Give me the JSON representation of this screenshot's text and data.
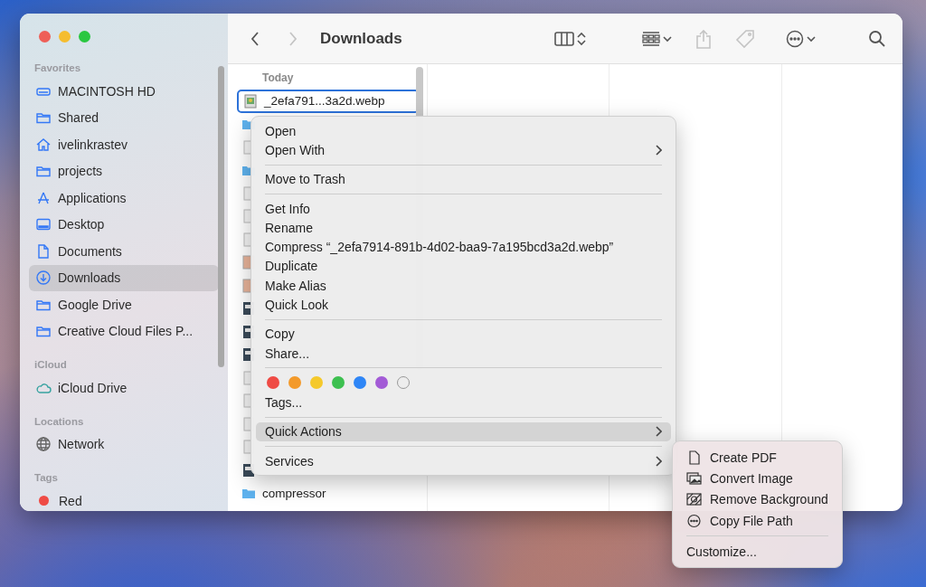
{
  "window": {
    "title": "Downloads"
  },
  "toolbar": {
    "back_disabled": false,
    "forward_disabled": true,
    "share_disabled": true,
    "tags_disabled": true
  },
  "sidebar": {
    "sections": [
      {
        "heading": "Favorites",
        "items": [
          {
            "label": "MACINTOSH HD",
            "kind": "drive",
            "selected": false
          },
          {
            "label": "Shared",
            "kind": "folder",
            "selected": false
          },
          {
            "label": "ivelinkrastev",
            "kind": "home",
            "selected": false
          },
          {
            "label": "projects",
            "kind": "folder",
            "selected": false
          },
          {
            "label": "Applications",
            "kind": "apps",
            "selected": false
          },
          {
            "label": "Desktop",
            "kind": "desktop",
            "selected": false
          },
          {
            "label": "Documents",
            "kind": "document",
            "selected": false
          },
          {
            "label": "Downloads",
            "kind": "download",
            "selected": true
          },
          {
            "label": "Google Drive",
            "kind": "folder",
            "selected": false
          },
          {
            "label": "Creative Cloud Files P...",
            "kind": "folder",
            "selected": false
          }
        ]
      },
      {
        "heading": "iCloud",
        "items": [
          {
            "label": "iCloud Drive",
            "kind": "cloud",
            "selected": false
          }
        ]
      },
      {
        "heading": "Locations",
        "items": [
          {
            "label": "Network",
            "kind": "globe",
            "selected": false
          }
        ]
      },
      {
        "heading": "Tags",
        "items": [
          {
            "label": "Red",
            "kind": "tag",
            "color": "#ef4b45",
            "selected": false
          }
        ]
      }
    ]
  },
  "file_list": {
    "heading": "Today",
    "items": [
      {
        "name": "_2efa791...3a2d.webp",
        "kind": "image",
        "selected": true
      },
      {
        "kind": "folder",
        "selected": false
      },
      {
        "kind": "doc",
        "selected": false
      },
      {
        "kind": "folder",
        "selected": false
      },
      {
        "kind": "doc",
        "selected": false
      },
      {
        "kind": "doc",
        "selected": false
      },
      {
        "kind": "doc",
        "selected": false
      },
      {
        "kind": "photo",
        "selected": false
      },
      {
        "kind": "photo",
        "selected": false
      },
      {
        "kind": "app",
        "selected": false
      },
      {
        "kind": "app",
        "selected": false
      },
      {
        "kind": "app",
        "selected": false
      },
      {
        "kind": "doc",
        "selected": false
      },
      {
        "kind": "doc",
        "selected": false
      },
      {
        "kind": "doc",
        "selected": false
      },
      {
        "kind": "doc",
        "selected": false
      },
      {
        "kind": "app",
        "selected": false
      },
      {
        "name": "compressor",
        "kind": "folder",
        "selected": false
      }
    ]
  },
  "context_menu": {
    "items": [
      {
        "kind": "item",
        "label": "Open",
        "submenu": false,
        "selected": false
      },
      {
        "kind": "item",
        "label": "Open With",
        "submenu": true,
        "selected": false
      },
      {
        "kind": "separator"
      },
      {
        "kind": "item",
        "label": "Move to Trash",
        "submenu": false,
        "selected": false
      },
      {
        "kind": "separator"
      },
      {
        "kind": "item",
        "label": "Get Info",
        "submenu": false,
        "selected": false
      },
      {
        "kind": "item",
        "label": "Rename",
        "submenu": false,
        "selected": false
      },
      {
        "kind": "item",
        "label": "Compress “_2efa7914-891b-4d02-baa9-7a195bcd3a2d.webp”",
        "submenu": false,
        "selected": false
      },
      {
        "kind": "item",
        "label": "Duplicate",
        "submenu": false,
        "selected": false
      },
      {
        "kind": "item",
        "label": "Make Alias",
        "submenu": false,
        "selected": false
      },
      {
        "kind": "item",
        "label": "Quick Look",
        "submenu": false,
        "selected": false
      },
      {
        "kind": "separator"
      },
      {
        "kind": "item",
        "label": "Copy",
        "submenu": false,
        "selected": false
      },
      {
        "kind": "item",
        "label": "Share...",
        "submenu": false,
        "selected": false
      },
      {
        "kind": "separator"
      },
      {
        "kind": "tags",
        "tags": [
          {
            "kind": "color",
            "color": "#ef4b45"
          },
          {
            "kind": "color",
            "color": "#f39a2b"
          },
          {
            "kind": "color",
            "color": "#f5c92b"
          },
          {
            "kind": "color",
            "color": "#3dc050"
          },
          {
            "kind": "color",
            "color": "#2f86f6"
          },
          {
            "kind": "color",
            "color": "#a35bd6"
          },
          {
            "kind": "none"
          }
        ]
      },
      {
        "kind": "item",
        "label": "Tags...",
        "submenu": false,
        "selected": false
      },
      {
        "kind": "separator"
      },
      {
        "kind": "item",
        "label": "Quick Actions",
        "submenu": true,
        "selected": true
      },
      {
        "kind": "separator"
      },
      {
        "kind": "item",
        "label": "Services",
        "submenu": true,
        "selected": false
      }
    ]
  },
  "submenu": {
    "items": [
      {
        "kind": "document",
        "label": "Create PDF"
      },
      {
        "kind": "images",
        "label": "Convert Image"
      },
      {
        "kind": "background",
        "label": "Remove Background"
      },
      {
        "kind": "ellipsis",
        "label": "Copy File Path"
      },
      {
        "kind": "separator"
      },
      {
        "kind": "plain",
        "label": "Customize..."
      }
    ]
  }
}
